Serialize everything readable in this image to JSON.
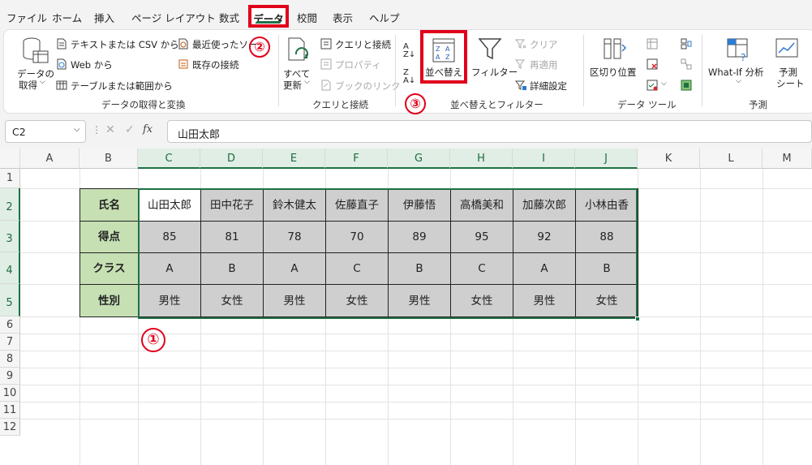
{
  "menu": {
    "items": [
      "ファイル",
      "ホーム",
      "挿入",
      "ページ レイアウト",
      "数式",
      "校閲",
      "表示",
      "ヘルプ"
    ],
    "active": "データ"
  },
  "ribbon": {
    "get_data": {
      "main_label_1": "データの",
      "main_label_2": "取得",
      "text_csv": "テキストまたは CSV から",
      "web": "Web から",
      "table_range": "テーブルまたは範囲から",
      "recent_sources": "最近使ったソース",
      "existing_connections": "既存の接続",
      "group_label": "データの取得と変換"
    },
    "queries": {
      "refresh_1": "すべて",
      "refresh_2": "更新",
      "queries_connections": "クエリと接続",
      "properties": "プロパティ",
      "edit_links": "ブックのリンク",
      "group_label": "クエリと接続"
    },
    "sort_filter": {
      "sort": "並べ替え",
      "filter": "フィルター",
      "clear": "クリア",
      "reapply": "再適用",
      "advanced": "詳細設定",
      "group_label": "並べ替えとフィルター"
    },
    "data_tools": {
      "text_to_columns": "区切り位置",
      "group_label": "データ ツール"
    },
    "forecast": {
      "whatif": "What-If 分析",
      "forecast_sheet_1": "予測",
      "forecast_sheet_2": "シート",
      "group_label": "予測"
    }
  },
  "annotations": [
    "①",
    "②",
    "③"
  ],
  "formula_bar": {
    "name_box": "C2",
    "fx": "fx",
    "value": "山田太郎"
  },
  "sheet": {
    "columns": [
      "A",
      "B",
      "C",
      "D",
      "E",
      "F",
      "G",
      "H",
      "I",
      "J",
      "K",
      "L",
      "M"
    ],
    "rows": [
      "1",
      "2",
      "3",
      "4",
      "5",
      "6",
      "7",
      "8",
      "9",
      "10",
      "11",
      "12"
    ],
    "row_labels": [
      "氏名",
      "得点",
      "クラス",
      "性別"
    ],
    "names": [
      "山田太郎",
      "田中花子",
      "鈴木健太",
      "佐藤直子",
      "伊藤悟",
      "高橋美和",
      "加藤次郎",
      "小林由香"
    ],
    "scores": [
      "85",
      "81",
      "78",
      "70",
      "89",
      "95",
      "92",
      "88"
    ],
    "classes": [
      "A",
      "B",
      "A",
      "C",
      "B",
      "C",
      "A",
      "B"
    ],
    "genders": [
      "男性",
      "女性",
      "男性",
      "女性",
      "男性",
      "女性",
      "男性",
      "女性"
    ]
  }
}
